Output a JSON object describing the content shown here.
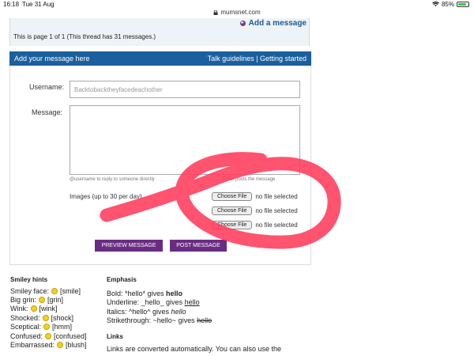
{
  "status": {
    "time": "16:18",
    "date": "Tue 31 Aug",
    "battery": "85%",
    "battery_level": 0.85,
    "url": "mumsnet.com"
  },
  "thread": {
    "add_message": "Add a message",
    "page_info": "This is page 1 of 1 (This thread has 31 messages.)"
  },
  "form": {
    "header_title": "Add your message here",
    "header_links": "Talk guidelines | Getting started",
    "username_label": "Username:",
    "username_value": "Backtobacktheyfacedeachother",
    "message_label": "Message:",
    "hint_user": "@username to reply to someone directly",
    "hint_right": "Enter posts the message",
    "images_label": "Images (up to 30 per day)",
    "file_button": "Choose File",
    "no_file": "no file selected",
    "preview_button": "PREVIEW MESSAGE",
    "post_button": "POST MESSAGE"
  },
  "smileys": {
    "title": "Smiley hints",
    "items": [
      {
        "label": "Smiley face:",
        "code": "[smile]"
      },
      {
        "label": "Big grin:",
        "code": "[grin]"
      },
      {
        "label": "Wink:",
        "code": "[wink]"
      },
      {
        "label": "Shocked:",
        "code": "[shock]"
      },
      {
        "label": "Sceptical:",
        "code": "[hmm]"
      },
      {
        "label": "Confused:",
        "code": "[confused]"
      },
      {
        "label": "Embarrassed:",
        "code": "[blush]"
      }
    ]
  },
  "emphasis": {
    "title": "Emphasis",
    "bold_prefix": "Bold: *hello* gives ",
    "bold_word": "hello",
    "underline_prefix": "Underline: _hello_ gives ",
    "underline_word": "hello",
    "italic_prefix": "Italics: ^hello^ gives ",
    "italic_word": "hello",
    "strike_prefix": "Strikethrough: ~hello~ gives ",
    "strike_word": "hello",
    "links_title": "Links",
    "links_text": "Links are converted automatically. You can also use the"
  },
  "colors": {
    "header_blue": "#1a5f9e",
    "button_purple": "#6a2c82",
    "scribble_red": "#ff3b5c"
  }
}
